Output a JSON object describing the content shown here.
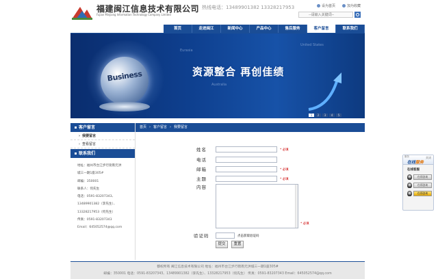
{
  "header": {
    "company_name": "福建闽江信息技术有限公司",
    "company_en": "Fujian Minjiang Information Technology Company Limited",
    "hotline": "热线电话：13489901382 13328217953",
    "top_links": [
      "设为首页",
      "加为收藏"
    ],
    "search_placeholder": "--请输入关键词--"
  },
  "nav": {
    "items": [
      "首页",
      "走进闽江",
      "新闻中心",
      "产品中心",
      "售后服务",
      "客户留言",
      "联系我们"
    ],
    "active_index": 5
  },
  "banner": {
    "slogan": "资源整合  再创佳绩",
    "globe_text": "Business",
    "words": [
      "United States",
      "Australia",
      "Eurasia"
    ],
    "dots": [
      "1",
      "2",
      "3",
      "4",
      "5"
    ]
  },
  "sidebar": {
    "section1_title": "客户留言",
    "items": [
      "我要留言",
      "查看留言"
    ],
    "section2_title": "联系我们",
    "contact": [
      "地址：福州市台江步行街南元洪",
      "城三一期1座305#",
      "邮编：350001",
      "联系人：何先生",
      "电话：0591-83207343、",
      "13489901382（李先生）、",
      "13328217953（何先生）",
      "传真：0591-83207343",
      "Email：645052574@qq.com"
    ]
  },
  "breadcrumb": [
    "首页",
    "客户留言",
    "我要留言"
  ],
  "form": {
    "name_label": "姓名",
    "phone_label": "电话",
    "email_label": "邮箱",
    "subject_label": "主题",
    "content_label": "内容",
    "captcha_label": "验证码",
    "required": "* 必填",
    "captcha_tip": "点击获取验证码",
    "submit": "提交",
    "reset": "重置"
  },
  "footer": {
    "line1": "都权所有 闽江信息技术有限公司 地址：福州市台江步行街南元洪城三一期1座305#",
    "line2": "邮编：350001 电话：0591-83207343、13489901382（李先生）、13328217953（何先生） 传真：0591-83207343 Email：645052574@qq.com"
  },
  "service": {
    "tag": "服务",
    "title_a": "在线",
    "title_b": "服务",
    "close": "关闭",
    "subtitle": "在线客服",
    "buttons": [
      "在线咨询",
      "在线咨询",
      "在线咨询"
    ]
  },
  "colors": {
    "nav_blue": "#1a4d96",
    "required_red": "#cc0000"
  }
}
